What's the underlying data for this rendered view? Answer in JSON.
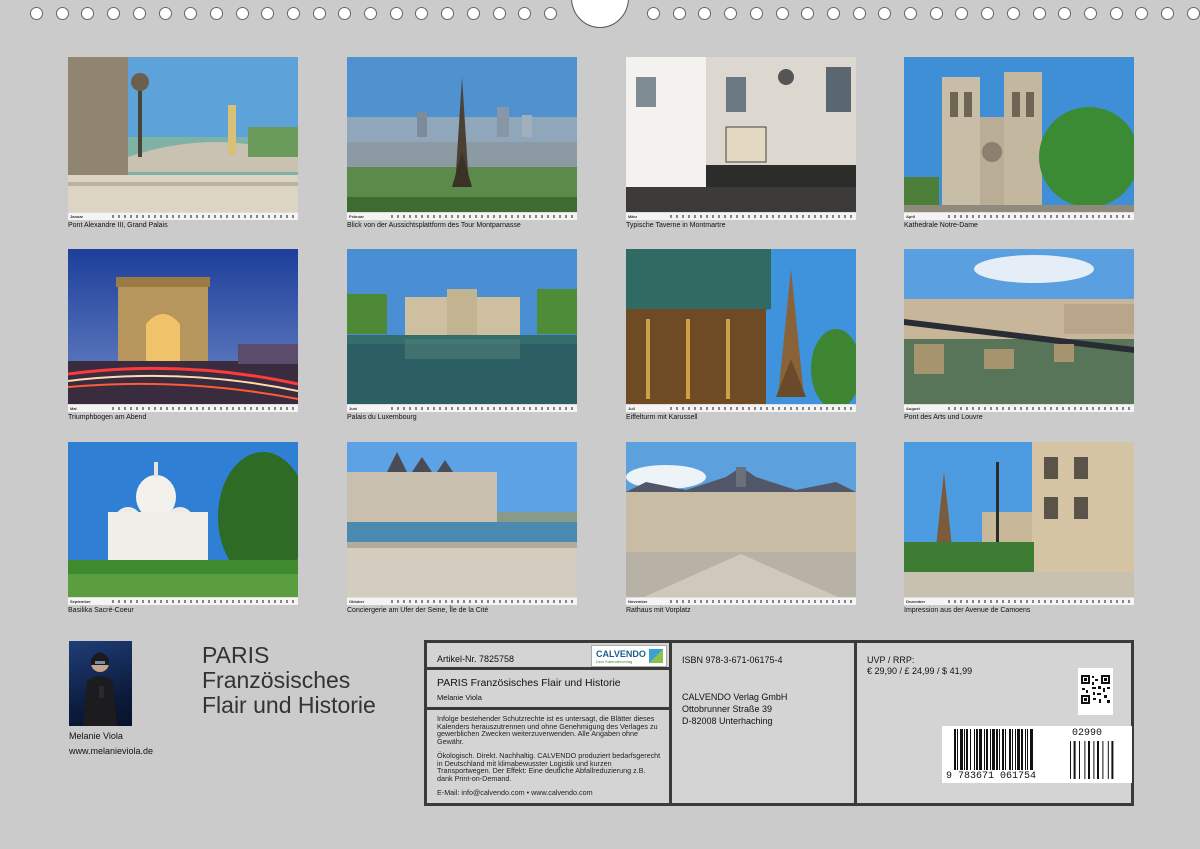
{
  "calendar": {
    "title_lines": [
      "PARIS",
      "Französisches",
      "Flair und Historie"
    ],
    "author": "Melanie Viola",
    "website": "www.melanieviola.de"
  },
  "months": [
    {
      "month": "Januar",
      "caption": "Pont Alexandre III, Grand Palais"
    },
    {
      "month": "Februar",
      "caption": "Blick von der Aussichtsplattform des Tour Montparnasse"
    },
    {
      "month": "März",
      "caption": "Typische Taverne in Montmartre"
    },
    {
      "month": "April",
      "caption": "Kathedrale Notre-Dame"
    },
    {
      "month": "Mai",
      "caption": "Triumphbogen am Abend"
    },
    {
      "month": "Juni",
      "caption": "Palais du Luxembourg"
    },
    {
      "month": "Juli",
      "caption": "Eiffelturm mit Karussell"
    },
    {
      "month": "August",
      "caption": "Pont des Arts und Louvre"
    },
    {
      "month": "September",
      "caption": "Basilika Sacré-Coeur"
    },
    {
      "month": "Oktober",
      "caption": "Conciergerie am Ufer der Seine, Île de la Cité"
    },
    {
      "month": "November",
      "caption": "Rathaus mit Vorplatz"
    },
    {
      "month": "Dezember",
      "caption": "Impression aus der Avenue de Camoens"
    }
  ],
  "info": {
    "article_no": "Artikel-Nr. 7825758",
    "product_title": "PARIS Französisches Flair und Historie",
    "product_author": "Melanie Viola",
    "legal_text": "Infolge bestehender Schutzrechte ist es untersagt, die Blätter dieses Kalenders herauszutrennen und ohne Genehmigung des Verlages zu gewerblichen Zwecken weiterzuverwenden. Alle Angaben ohne Gewähr.",
    "eco_text": "Ökologisch. Direkt. Nachhaltig. CALVENDO produziert bedarfsgerecht in Deutschland mit klimabewusster Logistik und kurzen Transportwegen. Der Effekt: Eine deutliche Abfallreduzierung z.B. dank Print-on-Demand.",
    "contact": "E-Mail: info@calvendo.com • www.calvendo.com",
    "logo_text": "CALVENDO",
    "logo_subtext": "Dein Kalenderverlag",
    "isbn": "ISBN 978-3-671-06175-4",
    "publisher": [
      "CALVENDO Verlag GmbH",
      "Ottobrunner Straße 39",
      "D-82008 Unterhaching"
    ],
    "price_label": "UVP / RRP:",
    "price": "€ 29,90 / £ 24,99 / $ 41,99",
    "barcode_main": "9 783671 061754",
    "barcode_addon": "02990"
  },
  "colors": {
    "background": "#cbcbcb",
    "box_border": "#3a3a3a"
  }
}
